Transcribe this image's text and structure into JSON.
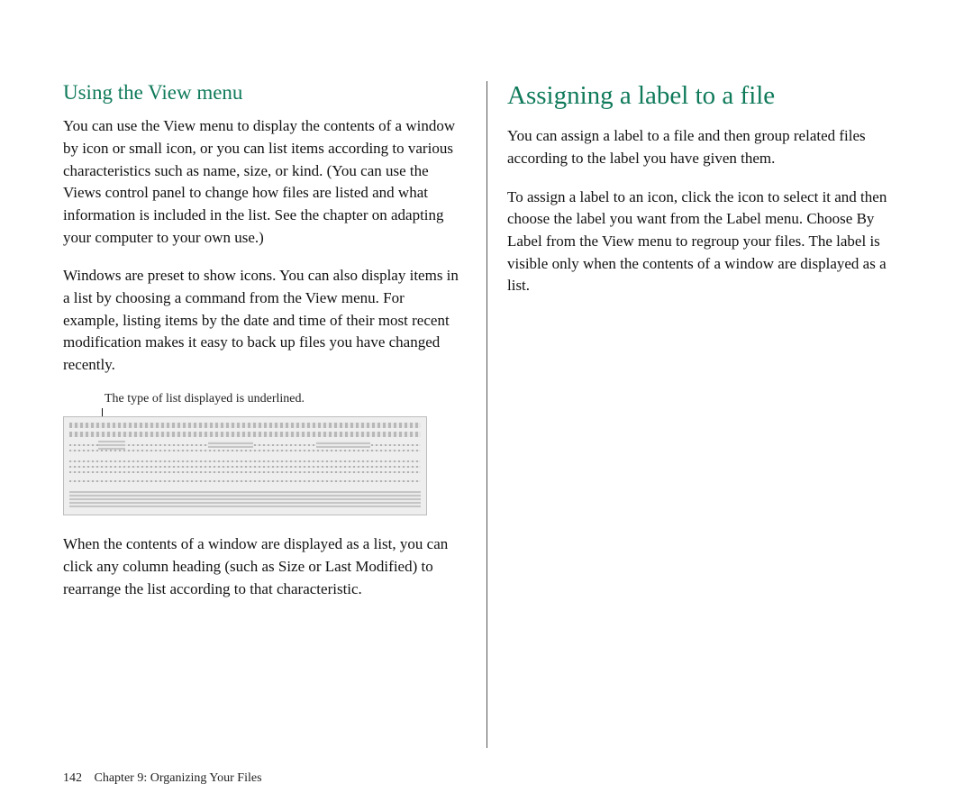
{
  "left": {
    "heading": "Using the View menu",
    "p1": "You can use the View menu to display the contents of a window by icon or small icon, or you can list items according to various characteristics such as name, size, or kind. (You can use the Views control panel to change how files are listed and what information is included in the list. See the chapter on adapting your computer to your own use.)",
    "p2": "Windows are preset to show icons. You can also display items in a list by choosing a command from the View menu. For example, listing items by the date and time of their most recent modification makes it easy to back up files you have changed recently.",
    "caption": "The type of list displayed is underlined.",
    "p3": "When the contents of a window are displayed as a list, you can click any column heading (such as Size or Last Modified) to rearrange the list according to that characteristic."
  },
  "right": {
    "heading": "Assigning a label to a file",
    "p1": "You can assign a label to a file and then group related files according to the label you have given them.",
    "p2": "To assign a label to an icon, click the icon to select it and then choose the label you want from the Label menu.  Choose By Label from the View menu to regroup your files. The label is visible only when the contents of a window are displayed as a list."
  },
  "footer": {
    "page_number": "142",
    "chapter": "Chapter 9: Organizing Your Files"
  }
}
